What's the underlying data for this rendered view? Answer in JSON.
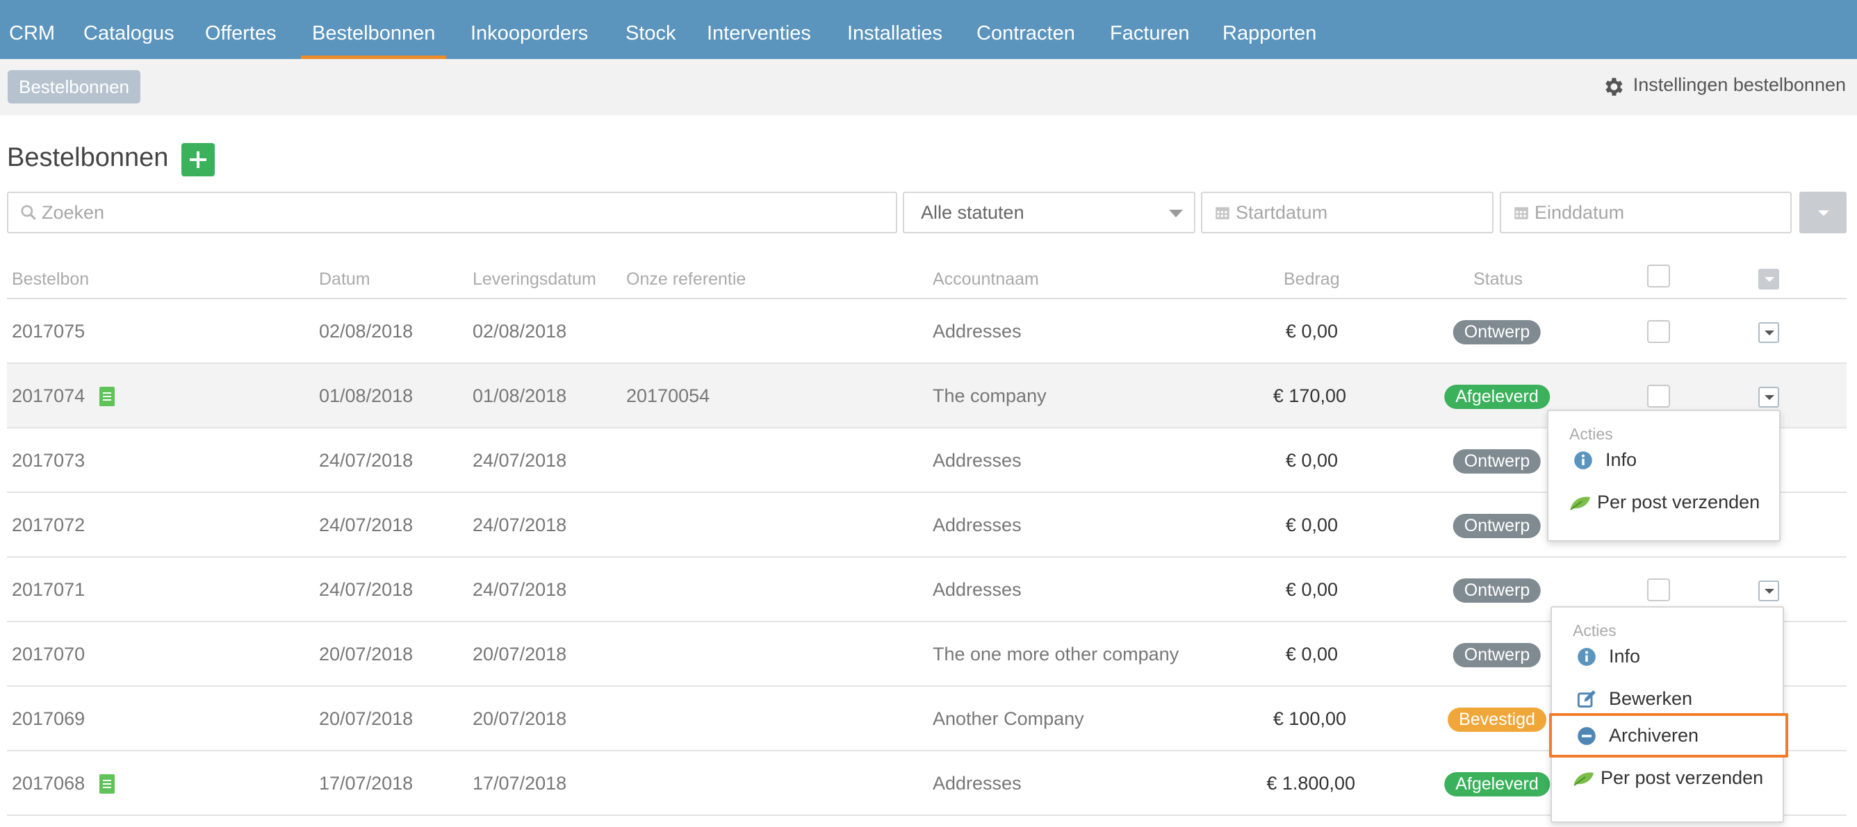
{
  "nav": {
    "items": [
      "CRM",
      "Catalogus",
      "Offertes",
      "Bestelbonnen",
      "Inkooporders",
      "Stock",
      "Interventies",
      "Installaties",
      "Contracten",
      "Facturen",
      "Rapporten"
    ],
    "active": "Bestelbonnen"
  },
  "breadcrumb": "Bestelbonnen",
  "settings_link": "Instellingen bestelbonnen",
  "page_title": "Bestelbonnen",
  "filters": {
    "search_placeholder": "Zoeken",
    "status_value": "Alle statuten",
    "start_placeholder": "Startdatum",
    "end_placeholder": "Einddatum"
  },
  "table": {
    "headers": {
      "bestelbon": "Bestelbon",
      "datum": "Datum",
      "leveringsdatum": "Leveringsdatum",
      "referentie": "Onze referentie",
      "account": "Accountnaam",
      "bedrag": "Bedrag",
      "status": "Status"
    },
    "rows": [
      {
        "id": "2017075",
        "datum": "02/08/2018",
        "levering": "02/08/2018",
        "ref": "",
        "account": "Addresses",
        "bedrag": "€ 0,00",
        "status": "Ontwerp",
        "doc": false
      },
      {
        "id": "2017074",
        "datum": "01/08/2018",
        "levering": "01/08/2018",
        "ref": "20170054",
        "account": "The company",
        "bedrag": "€ 170,00",
        "status": "Afgeleverd",
        "doc": true
      },
      {
        "id": "2017073",
        "datum": "24/07/2018",
        "levering": "24/07/2018",
        "ref": "",
        "account": "Addresses",
        "bedrag": "€ 0,00",
        "status": "Ontwerp",
        "doc": false
      },
      {
        "id": "2017072",
        "datum": "24/07/2018",
        "levering": "24/07/2018",
        "ref": "",
        "account": "Addresses",
        "bedrag": "€ 0,00",
        "status": "Ontwerp",
        "doc": false
      },
      {
        "id": "2017071",
        "datum": "24/07/2018",
        "levering": "24/07/2018",
        "ref": "",
        "account": "Addresses",
        "bedrag": "€ 0,00",
        "status": "Ontwerp",
        "doc": false
      },
      {
        "id": "2017070",
        "datum": "20/07/2018",
        "levering": "20/07/2018",
        "ref": "",
        "account": "The one more other company",
        "bedrag": "€ 0,00",
        "status": "Ontwerp",
        "doc": false
      },
      {
        "id": "2017069",
        "datum": "20/07/2018",
        "levering": "20/07/2018",
        "ref": "",
        "account": "Another Company",
        "bedrag": "€ 100,00",
        "status": "Bevestigd",
        "doc": false
      },
      {
        "id": "2017068",
        "datum": "17/07/2018",
        "levering": "17/07/2018",
        "ref": "",
        "account": "Addresses",
        "bedrag": "€ 1.800,00",
        "status": "Afgeleverd",
        "doc": true
      }
    ]
  },
  "menu1": {
    "header": "Acties",
    "items": [
      {
        "label": "Info",
        "icon": "info-icon"
      },
      {
        "label": "Per post verzenden",
        "icon": "leaf-icon"
      }
    ]
  },
  "menu2": {
    "header": "Acties",
    "items": [
      {
        "label": "Info",
        "icon": "info-icon"
      },
      {
        "label": "Bewerken",
        "icon": "edit-icon"
      },
      {
        "label": "Archiveren",
        "icon": "minus-circle-icon"
      },
      {
        "label": "Per post verzenden",
        "icon": "leaf-icon"
      }
    ]
  },
  "colors": {
    "nav": "#5b94bd",
    "active_underline": "#ec8b2a",
    "ontwerp": "#7f8a91",
    "afgeleverd": "#3bb15c",
    "bevestigd": "#f0a73a",
    "highlight": "#f07c2c"
  }
}
